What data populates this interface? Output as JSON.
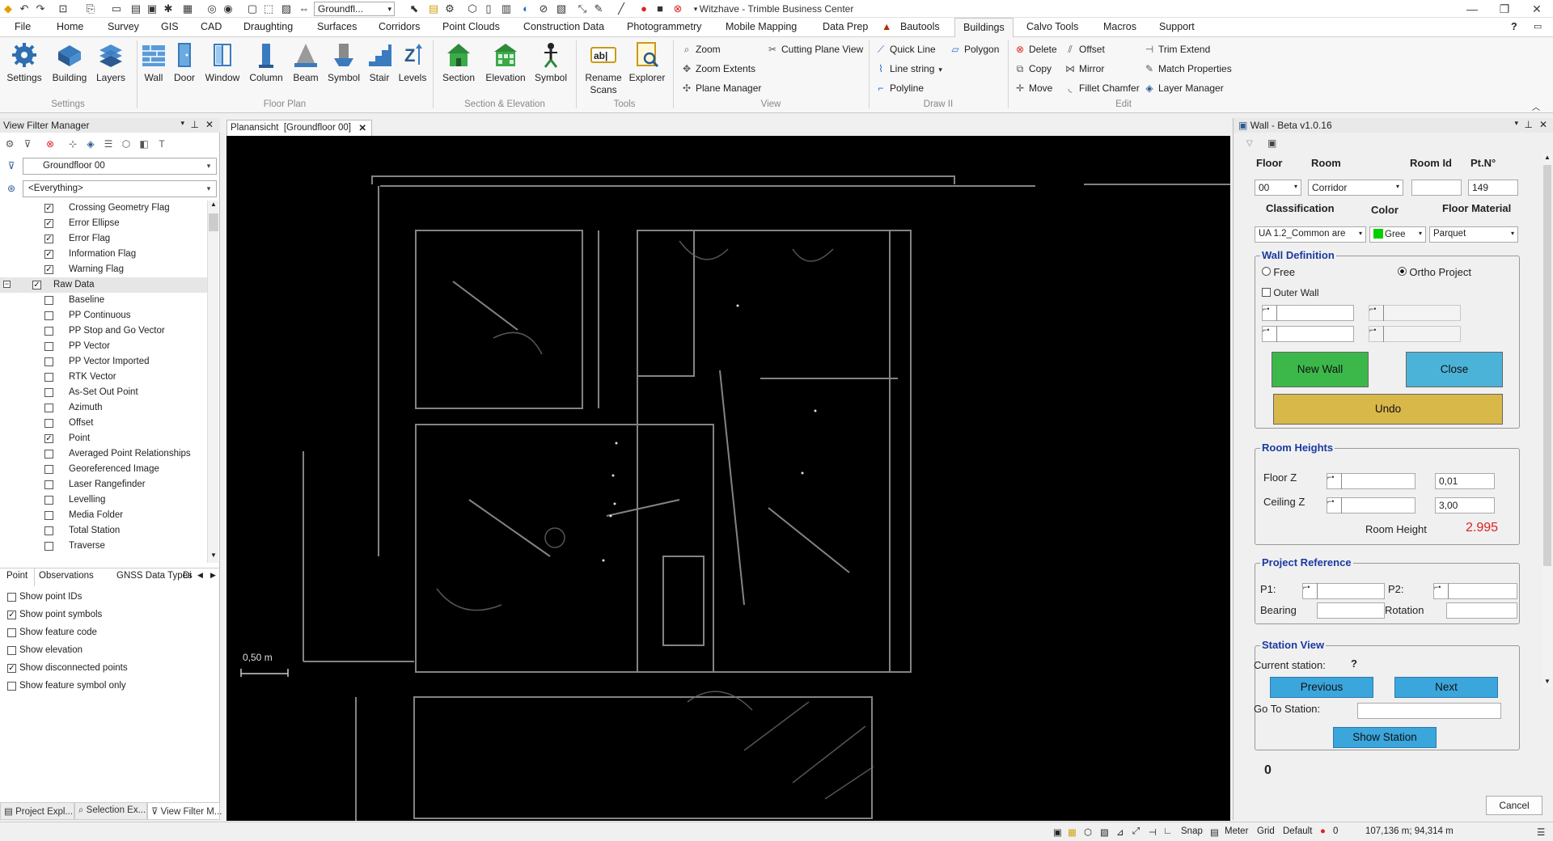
{
  "window": {
    "title": "Witzhave - Trimble Business Center",
    "help": "?"
  },
  "quickaccess": {
    "view_select": "Groundfl..."
  },
  "menu": [
    "File",
    "Home",
    "Survey",
    "GIS",
    "CAD",
    "Draughting",
    "Surfaces",
    "Corridors",
    "Point Clouds",
    "Construction Data",
    "Photogrammetry",
    "Mobile Mapping",
    "Data Prep",
    "Bautools",
    "Buildings",
    "Calvo Tools",
    "Macros",
    "Support"
  ],
  "ribbon": {
    "settings_group": {
      "buttons": [
        "Settings",
        "Building",
        "Layers"
      ],
      "name": "Settings"
    },
    "floorplan_group": {
      "buttons": [
        "Wall",
        "Door",
        "Window",
        "Column",
        "Beam",
        "Symbol",
        "Stair",
        "Levels"
      ],
      "name": "Floor Plan"
    },
    "section_group": {
      "buttons": [
        "Section",
        "Elevation",
        "Symbol"
      ],
      "name": "Section & Elevation"
    },
    "tools_group": {
      "buttons": [
        "Rename Scans",
        "Explorer"
      ],
      "name": "Tools"
    },
    "view_group": {
      "items": [
        "Zoom",
        "Zoom Extents",
        "Plane Manager",
        "Cutting Plane View"
      ],
      "name": "View"
    },
    "draw_group": {
      "items": [
        "Quick Line",
        "Line string",
        "Polyline",
        "Polygon"
      ],
      "name": "Draw II"
    },
    "edit_group": {
      "items": [
        "Delete",
        "Copy",
        "Move",
        "Offset",
        "Mirror",
        "Fillet Chamfer",
        "Trim Extend",
        "Match Properties",
        "Layer Manager"
      ],
      "name": "Edit"
    }
  },
  "left_panel": {
    "title": "View Filter Manager",
    "view_combo": "Groundfloor 00",
    "filter_combo": "<Everything>",
    "tree": [
      {
        "label": "Crossing Geometry Flag",
        "checked": true
      },
      {
        "label": "Error Ellipse",
        "checked": true
      },
      {
        "label": "Error Flag",
        "checked": true
      },
      {
        "label": "Information Flag",
        "checked": true
      },
      {
        "label": "Warning Flag",
        "checked": true
      },
      {
        "label": "Raw Data",
        "checked": true
      },
      {
        "label": "Baseline",
        "checked": false
      },
      {
        "label": "PP Continuous",
        "checked": false
      },
      {
        "label": "PP Stop and Go Vector",
        "checked": false
      },
      {
        "label": "PP Vector",
        "checked": false
      },
      {
        "label": "PP Vector Imported",
        "checked": false
      },
      {
        "label": "RTK Vector",
        "checked": false
      },
      {
        "label": "As-Set Out Point",
        "checked": false
      },
      {
        "label": "Azimuth",
        "checked": false
      },
      {
        "label": "Offset",
        "checked": false
      },
      {
        "label": "Point",
        "checked": true
      },
      {
        "label": "Averaged Point Relationships",
        "checked": false
      },
      {
        "label": "Georeferenced Image",
        "checked": false
      },
      {
        "label": "Laser Rangefinder",
        "checked": false
      },
      {
        "label": "Levelling",
        "checked": false
      },
      {
        "label": "Media Folder",
        "checked": false
      },
      {
        "label": "Total Station",
        "checked": false
      },
      {
        "label": "Traverse",
        "checked": false
      }
    ],
    "tabs": [
      "Point",
      "Observations",
      "GNSS Data Types",
      "Di"
    ],
    "options": [
      {
        "label": "Show point IDs",
        "checked": false
      },
      {
        "label": "Show point symbols",
        "checked": true
      },
      {
        "label": "Show feature code",
        "checked": false
      },
      {
        "label": "Show elevation",
        "checked": false
      },
      {
        "label": "Show disconnected points",
        "checked": true
      },
      {
        "label": "Show feature symbol only",
        "checked": false
      }
    ],
    "bottom_tabs": [
      "Project Expl...",
      "Selection Ex...",
      "View Filter M..."
    ]
  },
  "document": {
    "tab": "Planansicht  [Groundfloor 00]",
    "scale": "0,50 m"
  },
  "wall_panel": {
    "title": "Wall - Beta v1.0.16",
    "headers": {
      "floor": "Floor",
      "room": "Room",
      "room_id": "Room Id",
      "pt_no": "Pt.N°"
    },
    "floor_value": "00",
    "room_value": "Corridor",
    "room_id_value": "",
    "pt_no_value": "149",
    "labels2": {
      "classification": "Classification",
      "color": "Color",
      "floor_material": "Floor Material"
    },
    "classification_value": "UA 1.2_Common are",
    "color_value": "Gree",
    "color_swatch": "#00d000",
    "floor_material_value": "Parquet",
    "wall_def": {
      "title": "Wall Definition",
      "free": "Free",
      "ortho": "Ortho Project",
      "outer_wall": "Outer Wall",
      "new_wall": "New Wall",
      "close": "Close",
      "undo": "Undo"
    },
    "room_heights": {
      "title": "Room Heights",
      "floor_z": "Floor Z",
      "floor_z_value": "0,01",
      "ceiling_z": "Ceiling Z",
      "ceiling_z_value": "3,00",
      "room_height": "Room Height",
      "room_height_value": "2.995"
    },
    "project_ref": {
      "title": "Project Reference",
      "p1": "P1:",
      "p2": "P2:",
      "bearing": "Bearing",
      "rotation": "Rotation"
    },
    "station_view": {
      "title": "Station View",
      "current": "Current station:",
      "current_value": "?",
      "previous": "Previous",
      "next": "Next",
      "goto": "Go To Station:",
      "show": "Show Station",
      "count": "0"
    },
    "cancel": "Cancel",
    "colors": {
      "green_btn": "#3cb84a",
      "blue_btn": "#4cb3d8",
      "undo_btn": "#d9b84a",
      "station_btn": "#3ba6dc",
      "height_red": "#e02020"
    }
  },
  "status": {
    "snap": "Snap",
    "meter": "Meter",
    "grid": "Grid",
    "default": "Default",
    "count": "0",
    "coords": "107,136 m; 94,314 m"
  }
}
